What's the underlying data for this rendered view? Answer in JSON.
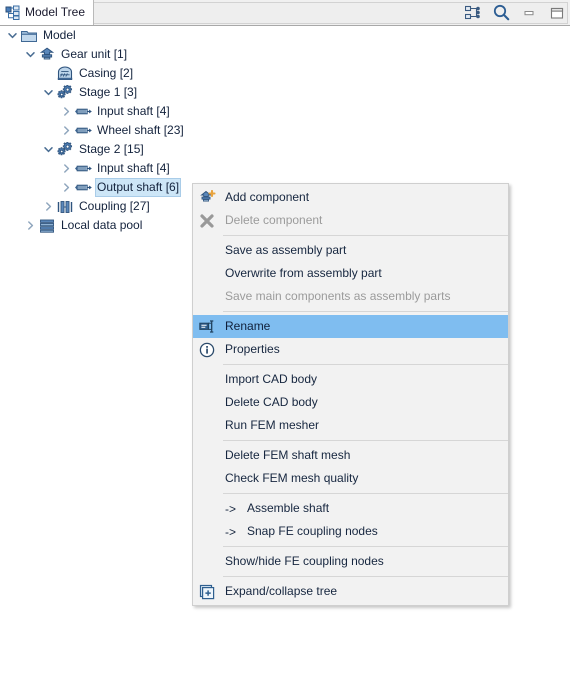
{
  "window": {
    "tab_label": "Model Tree",
    "tab_icon": "model-tree-icon",
    "buttons": [
      {
        "name": "link-with-editor-icon",
        "label": ""
      },
      {
        "name": "search-icon",
        "label": ""
      },
      {
        "name": "minimize-icon",
        "label": ""
      },
      {
        "name": "maximize-icon",
        "label": ""
      }
    ]
  },
  "tree": {
    "items": [
      {
        "label": "Model",
        "icon": "folder-icon",
        "indent": 0,
        "twisty": "expanded",
        "selected": false
      },
      {
        "label": "Gear unit [1]",
        "icon": "gear-unit-icon",
        "indent": 1,
        "twisty": "expanded",
        "selected": false
      },
      {
        "label": "Casing [2]",
        "icon": "casing-icon",
        "indent": 2,
        "twisty": "none",
        "selected": false
      },
      {
        "label": "Stage 1 [3]",
        "icon": "stage-icon",
        "indent": 2,
        "twisty": "expanded",
        "selected": false
      },
      {
        "label": "Input shaft [4]",
        "icon": "shaft-icon",
        "indent": 3,
        "twisty": "collapsed",
        "selected": false
      },
      {
        "label": "Wheel shaft [23]",
        "icon": "shaft-icon",
        "indent": 3,
        "twisty": "collapsed",
        "selected": false
      },
      {
        "label": "Stage 2 [15]",
        "icon": "stage-icon",
        "indent": 2,
        "twisty": "expanded",
        "selected": false
      },
      {
        "label": "Input shaft [4]",
        "icon": "shaft-icon",
        "indent": 3,
        "twisty": "collapsed",
        "selected": false
      },
      {
        "label": "Output shaft [6]",
        "icon": "shaft-icon",
        "indent": 3,
        "twisty": "collapsed",
        "selected": true
      },
      {
        "label": "Coupling [27]",
        "icon": "coupling-icon",
        "indent": 2,
        "twisty": "collapsed",
        "selected": false
      },
      {
        "label": "Local data pool",
        "icon": "data-pool-icon",
        "indent": 1,
        "twisty": "collapsed",
        "selected": false
      }
    ]
  },
  "context_menu": {
    "items": [
      {
        "type": "item",
        "label": "Add component",
        "icon": "add-component-icon",
        "disabled": false,
        "highlight": false
      },
      {
        "type": "item",
        "label": "Delete component",
        "icon": "delete-component-icon",
        "disabled": true,
        "highlight": false
      },
      {
        "type": "separator"
      },
      {
        "type": "item",
        "label": "Save as assembly part",
        "icon": "",
        "disabled": false,
        "highlight": false
      },
      {
        "type": "item",
        "label": "Overwrite from assembly part",
        "icon": "",
        "disabled": false,
        "highlight": false
      },
      {
        "type": "item",
        "label": "Save main components as assembly parts",
        "icon": "",
        "disabled": true,
        "highlight": false
      },
      {
        "type": "separator"
      },
      {
        "type": "item",
        "label": "Rename",
        "icon": "rename-icon",
        "disabled": false,
        "highlight": true
      },
      {
        "type": "item",
        "label": "Properties",
        "icon": "properties-icon",
        "disabled": false,
        "highlight": false
      },
      {
        "type": "separator"
      },
      {
        "type": "item",
        "label": "Import CAD body",
        "icon": "",
        "disabled": false,
        "highlight": false
      },
      {
        "type": "item",
        "label": "Delete CAD body",
        "icon": "",
        "disabled": false,
        "highlight": false
      },
      {
        "type": "item",
        "label": "Run FEM mesher",
        "icon": "",
        "disabled": false,
        "highlight": false
      },
      {
        "type": "separator"
      },
      {
        "type": "item",
        "label": "Delete FEM shaft mesh",
        "icon": "",
        "disabled": false,
        "highlight": false
      },
      {
        "type": "item",
        "label": "Check FEM mesh quality",
        "icon": "",
        "disabled": false,
        "highlight": false
      },
      {
        "type": "separator"
      },
      {
        "type": "item",
        "label": "Assemble shaft",
        "arrow": "->",
        "icon": "",
        "disabled": false,
        "highlight": false
      },
      {
        "type": "item",
        "label": "Snap FE coupling nodes",
        "arrow": "->",
        "icon": "",
        "disabled": false,
        "highlight": false
      },
      {
        "type": "separator"
      },
      {
        "type": "item",
        "label": "Show/hide FE coupling nodes",
        "icon": "",
        "disabled": false,
        "highlight": false
      },
      {
        "type": "separator"
      },
      {
        "type": "item",
        "label": "Expand/collapse tree",
        "icon": "expand-collapse-icon",
        "disabled": false,
        "highlight": false
      }
    ]
  },
  "colors": {
    "menu_background": "#f2f2f2",
    "menu_highlight": "#7fbdf0",
    "tree_selection": "#cde6f7",
    "icon_blue": "#3a6ea5",
    "text": "#16263f"
  }
}
